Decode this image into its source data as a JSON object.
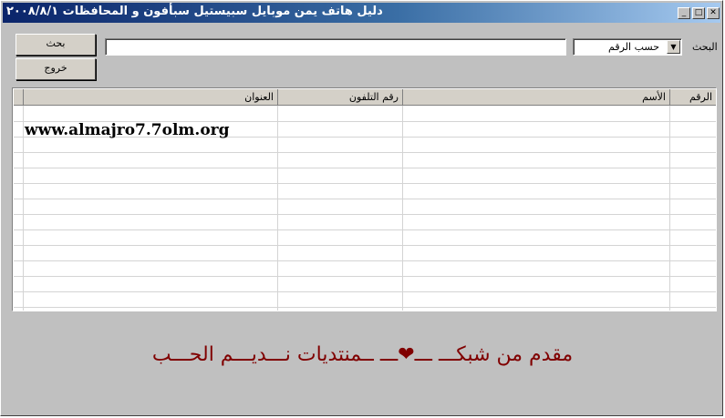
{
  "window": {
    "title": "دليل هاتف يمن موبايل سبيستيل سبأفون و المحافظات ٢٠٠٨/٨/١",
    "controls": [
      "_",
      "□",
      "✕"
    ]
  },
  "toolbar": {
    "search_button": "بحث",
    "exit_button": "خروج",
    "search_value": "",
    "search_by_selected": "حسب الرقم",
    "search_label": "البحث"
  },
  "table": {
    "columns": [
      "الرقم",
      "الأسم",
      "رقم التلفون",
      "العنوان"
    ],
    "first_row_address": "www.almajro7.7olm.org"
  },
  "footer": {
    "text": "مقدم من شبكـــ ـــ❤ـــ ــمنتديات نـــديـــم الحـــب"
  }
}
